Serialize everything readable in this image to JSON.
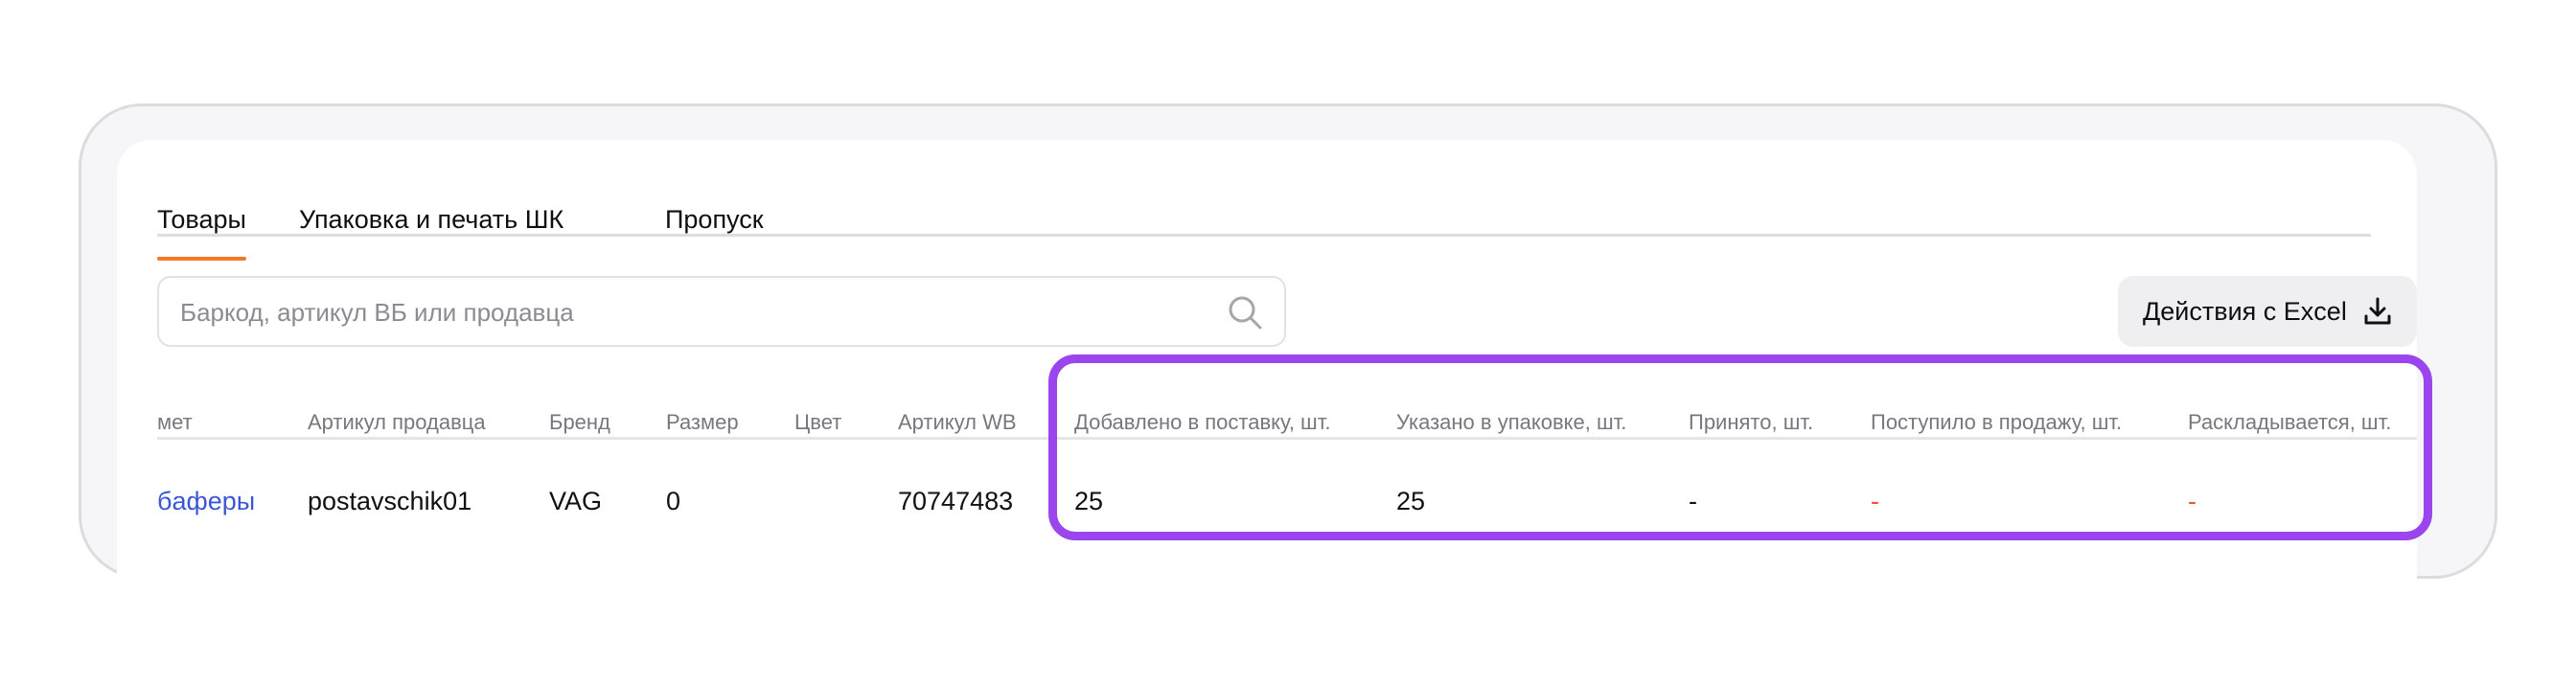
{
  "tabs": [
    {
      "label": "Товары",
      "active": true
    },
    {
      "label": "Упаковка и печать ШК",
      "active": false
    },
    {
      "label": "Пропуск",
      "active": false
    }
  ],
  "search": {
    "placeholder": "Баркод, артикул ВБ или продавца",
    "value": ""
  },
  "actions": {
    "excel_label": "Действия с Excel"
  },
  "table": {
    "headers": [
      "мет",
      "Артикул продавца",
      "Бренд",
      "Размер",
      "Цвет",
      "Артикул WB",
      "Добавлено в поставку, шт.",
      "Указано в упаковке, шт.",
      "Принято, шт.",
      "Поступило в продажу, шт.",
      "Раскладывается, шт."
    ],
    "row": [
      "бaферы",
      "postavschik01",
      "VAG",
      "0",
      "",
      "70747483",
      "25",
      "25",
      "-",
      "-",
      "-"
    ]
  },
  "colors": {
    "accent": "#f07a2b",
    "highlight": "#9a45ee",
    "link": "#3c57d6",
    "dash_red": "#f0542f"
  }
}
